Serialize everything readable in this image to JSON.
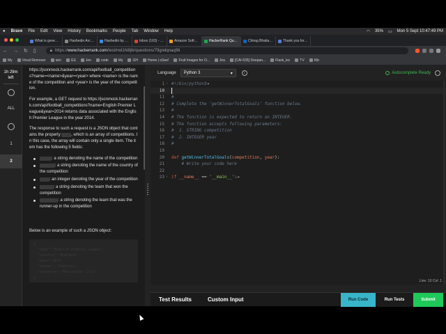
{
  "menubar": {
    "items": [
      "Brave",
      "File",
      "Edit",
      "View",
      "History",
      "Bookmarks",
      "People",
      "Tab",
      "Window",
      "Help"
    ],
    "battery": "35%",
    "datetime": "Mon 5 Sept  10:47:49 PM"
  },
  "tabs": [
    {
      "title": "What is gevent? — ge",
      "color": "#5a7bd8",
      "active": false
    },
    {
      "title": "Hashedin Archives - G",
      "color": "#888888",
      "active": false
    },
    {
      "title": "Hashedin by Deloitte I",
      "color": "#3a8ee6",
      "active": false
    },
    {
      "title": "Inbox (163) - deepan",
      "color": "#d44638",
      "active": false
    },
    {
      "title": "Amazon Software Dev",
      "color": "#f0a030",
      "active": false
    },
    {
      "title": "HackerRank Quest",
      "color": "#1ba94c",
      "active": true
    },
    {
      "title": "Chirag Bhatia - chirag",
      "color": "#0a66c2",
      "active": false
    },
    {
      "title": "Thank you for your ap",
      "color": "#5a7bd8",
      "active": false
    }
  ],
  "address": {
    "scheme": "https://",
    "host": "www.hackerrank.com",
    "path": "/test/md1hi8jtk/questions/79gndqnaq56"
  },
  "bookmarks": [
    "My",
    "Vocal Remover",
    "ukri",
    "GS",
    "Jen",
    "code",
    "My",
    "GH",
    "Home | oSee!",
    "Fruit Images for O...",
    "Jira",
    "[CAI-535] Deepan...",
    "Flask_Isc",
    "TV",
    "Kib"
  ],
  "rail": {
    "timer_value": "1h 29m",
    "timer_label": "left",
    "all_label": "ALL",
    "q1": "1",
    "q2": "2"
  },
  "description": {
    "p1": "https://jsonmock.hackerrank.com/api/football_competitions?name=<name>&year=<year> where <name> is the name of the competition and <year> is the year of the competition.",
    "p2": "For example, a GET request to https://jsonmock.hackerrank.com/api/football_competitions?name=English Premier League&year=2014 returns data associated with the English Premier League in the year 2014.",
    "p3a": "The response to such a request is a JSON object that contains the property",
    "p3_token": "data",
    "p3b": ", which is an array of competitions. In this case, the array will contain only a single item. The item has the following 5 fields:",
    "fields": [
      {
        "token": "name",
        "text": ": a string denoting the name of the competition"
      },
      {
        "token": "country",
        "text": ": a string denoting the name of the country of the competition"
      },
      {
        "token": "year",
        "text": ": an integer denoting the year of the competition"
      },
      {
        "token": "winner",
        "text": ": a string denoting the team that won the competition"
      },
      {
        "token": "runnerup",
        "text": ": a string denoting the team that was the runner-up in the competition"
      }
    ],
    "p4": "Below is an example of such a JSON object:",
    "json_sample": "{\n  \"name\":\"English Premier League\",\n  \"country\":\"England\",\n  \"year\":2014,\n  \"winner\":\"Chelsea\",\n  \"runnerup\":\"Manchester City\"\n}"
  },
  "editor": {
    "language_label": "Language",
    "language": "Python 3",
    "autocomplete": "Autocomplete Ready",
    "cursor_pos": "Line: 10 Col: 1",
    "lines": [
      {
        "n": "1",
        "fold": "›",
        "parts": [
          [
            "c-com",
            "#!/bin/python3"
          ],
          [
            "c-op",
            "→"
          ]
        ]
      },
      {
        "n": "10",
        "fold": "",
        "parts": []
      },
      {
        "n": "11",
        "fold": "",
        "parts": [
          [
            "c-com",
            "#"
          ]
        ]
      },
      {
        "n": "12",
        "fold": "",
        "parts": [
          [
            "c-com",
            "# Complete the 'getWinnerTotalGoals' function below."
          ]
        ]
      },
      {
        "n": "13",
        "fold": "",
        "parts": [
          [
            "c-com",
            "#"
          ]
        ]
      },
      {
        "n": "14",
        "fold": "",
        "parts": [
          [
            "c-com",
            "# The function is expected to return an INTEGER."
          ]
        ]
      },
      {
        "n": "15",
        "fold": "",
        "parts": [
          [
            "c-com",
            "# The function accepts following parameters:"
          ]
        ]
      },
      {
        "n": "16",
        "fold": "",
        "parts": [
          [
            "c-com",
            "#  1. STRING competition"
          ]
        ]
      },
      {
        "n": "17",
        "fold": "",
        "parts": [
          [
            "c-com",
            "#  2. INTEGER year"
          ]
        ]
      },
      {
        "n": "18",
        "fold": "",
        "parts": [
          [
            "c-com",
            "#"
          ]
        ]
      },
      {
        "n": "19",
        "fold": "",
        "parts": []
      },
      {
        "n": "20",
        "fold": "",
        "parts": [
          [
            "c-kw",
            "def "
          ],
          [
            "c-fn",
            "getWinnerTotalGoals"
          ],
          [
            "c-op",
            "("
          ],
          [
            "c-var",
            "competition"
          ],
          [
            "c-op",
            ", "
          ],
          [
            "c-var",
            "year"
          ],
          [
            "c-op",
            "):"
          ]
        ]
      },
      {
        "n": "21",
        "fold": "",
        "parts": [
          [
            "c-com",
            "    # Write your code here"
          ]
        ]
      },
      {
        "n": "22",
        "fold": "",
        "parts": [
          [
            "c-op",
            "    "
          ]
        ]
      },
      {
        "n": "23",
        "fold": "›",
        "parts": [
          [
            "c-kw",
            "if "
          ],
          [
            "c-var",
            "__name__"
          ],
          [
            "c-op",
            " == "
          ],
          [
            "c-str",
            "'__main__'"
          ],
          [
            "c-op",
            ":→"
          ]
        ]
      }
    ]
  },
  "bottom": {
    "test_results": "Test Results",
    "custom_input": "Custom Input",
    "run_code": "Run Code",
    "run_tests": "Run Tests",
    "submit": "Submit"
  }
}
